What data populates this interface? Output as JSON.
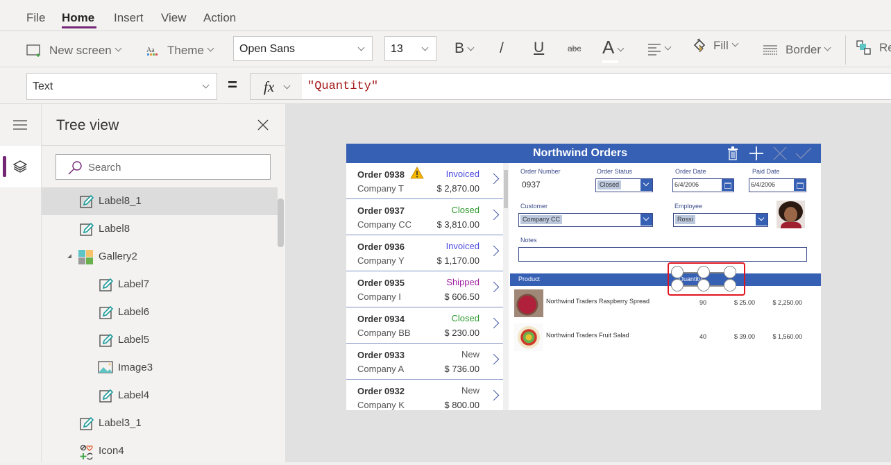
{
  "menu": {
    "items": [
      "File",
      "Home",
      "Insert",
      "View",
      "Action"
    ],
    "active": "Home"
  },
  "ribbon": {
    "new_screen": "New screen",
    "theme": "Theme",
    "font": "Open Sans",
    "font_size": "13",
    "bold": "B",
    "italic": "/",
    "underline": "U",
    "strikethrough": "abc",
    "font_color": "A",
    "fill": "Fill",
    "border": "Border",
    "reorder": "Re"
  },
  "formula_bar": {
    "property": "Text",
    "equals": "=",
    "fx": "fx",
    "formula": "\"Quantity\""
  },
  "tree_view": {
    "title": "Tree view",
    "search_placeholder": "Search",
    "items": [
      {
        "label": "Label8_1",
        "type": "label",
        "indent": 1,
        "selected": true
      },
      {
        "label": "Label8",
        "type": "label",
        "indent": 1
      },
      {
        "label": "Gallery2",
        "type": "gallery",
        "indent": 1,
        "expanded": true
      },
      {
        "label": "Label7",
        "type": "label",
        "indent": 2
      },
      {
        "label": "Label6",
        "type": "label",
        "indent": 2
      },
      {
        "label": "Label5",
        "type": "label",
        "indent": 2
      },
      {
        "label": "Image3",
        "type": "image",
        "indent": 2
      },
      {
        "label": "Label4",
        "type": "label",
        "indent": 2
      },
      {
        "label": "Label3_1",
        "type": "label",
        "indent": 1
      },
      {
        "label": "Icon4",
        "type": "icon",
        "indent": 1
      }
    ]
  },
  "app": {
    "title": "Northwind Orders",
    "header_icons": [
      "trash-icon",
      "add-icon",
      "cancel-icon",
      "check-icon"
    ],
    "orders": [
      {
        "order": "Order 0938",
        "company": "Company T",
        "status": "Invoiced",
        "amount": "$ 2,870.00",
        "warning": true
      },
      {
        "order": "Order 0937",
        "company": "Company CC",
        "status": "Closed",
        "amount": "$ 3,810.00"
      },
      {
        "order": "Order 0936",
        "company": "Company Y",
        "status": "Invoiced",
        "amount": "$ 1,170.00"
      },
      {
        "order": "Order 0935",
        "company": "Company I",
        "status": "Shipped",
        "amount": "$ 606.50"
      },
      {
        "order": "Order 0934",
        "company": "Company BB",
        "status": "Closed",
        "amount": "$ 230.00"
      },
      {
        "order": "Order 0933",
        "company": "Company A",
        "status": "New",
        "amount": "$ 736.00"
      },
      {
        "order": "Order 0932",
        "company": "Company K",
        "status": "New",
        "amount": "$ 800.00"
      }
    ],
    "status_colors": {
      "Invoiced": "#4a4ae0",
      "Closed": "#2e9a2e",
      "Shipped": "#a020a0",
      "New": "#555555"
    },
    "form": {
      "order_number_label": "Order Number",
      "order_number": "0937",
      "order_status_label": "Order Status",
      "order_status": "Closed",
      "order_date_label": "Order Date",
      "order_date": "6/4/2006",
      "paid_date_label": "Paid Date",
      "paid_date": "6/4/2006",
      "customer_label": "Customer",
      "customer": "Company CC",
      "employee_label": "Employee",
      "employee": "Rossi",
      "notes_label": "Notes",
      "notes": ""
    },
    "products_header": {
      "product": "Product",
      "quantity": "Quantity"
    },
    "products": [
      {
        "name": "Northwind Traders Raspberry Spread",
        "qty": "90",
        "price": "$ 25.00",
        "total": "$ 2,250.00"
      },
      {
        "name": "Northwind Traders Fruit Salad",
        "qty": "40",
        "price": "$ 39.00",
        "total": "$ 1,560.00"
      }
    ]
  },
  "colors": {
    "accent": "#742774",
    "app_blue": "#3660b4",
    "selection_red": "#e0141e"
  }
}
